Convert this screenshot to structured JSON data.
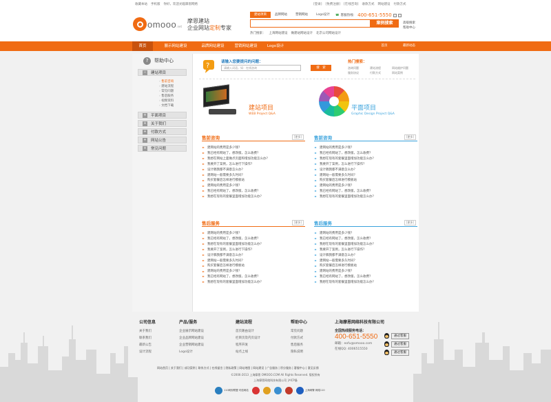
{
  "topbar": {
    "left": [
      "收藏本站",
      "手机版",
      "你好，欢迎光临摩恩网络"
    ],
    "right": [
      "[登录]",
      "[免费注册]",
      "[在线咨询]",
      "收款方式",
      "网站建设",
      "付款方式"
    ]
  },
  "header": {
    "logo_text": "omooo",
    "logo_suffix": ".net",
    "slogan_line1": "摩恩建站",
    "slogan_line2_pre": "企业网站",
    "slogan_line2_accent": "定制",
    "slogan_line2_post": "专家",
    "search_tabs": [
      "建站项目",
      "品牌网站",
      "营销网站",
      "Logo设计"
    ],
    "search_placeholder": "",
    "search_button": "案例搜索",
    "hotline_label": "客服热线：",
    "hotline_number": "400-651-5550",
    "side_links": [
      "高级搜索",
      "帮助中心"
    ],
    "hot_search_label": "热门搜索：",
    "hot_search": [
      "上海网站建设",
      "做建站网站设计",
      "北京公司网站设计"
    ]
  },
  "nav": {
    "items": [
      "首页",
      "展示网站建设",
      "品牌网站建设",
      "营销网站建设",
      "Logo设计"
    ],
    "right": [
      "设计作品展示",
      "最新动态"
    ]
  },
  "sidebar": {
    "title": "帮助中心",
    "sections": [
      {
        "label": "建站项目"
      },
      {
        "label": "平面项目"
      },
      {
        "label": "关于我们"
      },
      {
        "label": "付款方式"
      },
      {
        "label": "网站公告"
      },
      {
        "label": "常见问题"
      }
    ],
    "sub_items": [
      "售前咨询",
      "建站流程",
      "常见问题",
      "售后服务",
      "视频资料",
      "文档下载"
    ]
  },
  "question": {
    "label": "请输入您要提问的问题：",
    "input_placeholder": "请输入词语，如：在线咨询",
    "button": "搜　索",
    "hot_title": "热门搜索：",
    "hot_items": [
      "咨询问题",
      "建站流程",
      "网站维护问题",
      "服务协议",
      "付款方式",
      "网站案例"
    ]
  },
  "projects": [
    {
      "title": "建站项目",
      "subtitle": "WEB Project Q&A"
    },
    {
      "title": "平面项目",
      "subtitle": "Graphic Design Project Q&A"
    }
  ],
  "blocks": [
    {
      "title": "售前咨询",
      "more": "[更多]",
      "color": "orange",
      "items": [
        "建网站的费用是多少钱？",
        "我已经有网站了，想改版，怎么收费？",
        "我想在网站上面做点页面和增加功能怎么办？",
        "我要开了案例，怎么进行下操作？",
        "设计稿我都不满意怎么办？",
        "建网站一般需要多久时间？",
        "购买套餐后怎样进行模板站",
        "建网站的费用是多少钱？",
        "我已经有网站了，想改版，怎么收费？",
        "我想在现有的套餐里面增加功能怎么办？"
      ]
    },
    {
      "title": "售前咨询",
      "more": "[更多]",
      "color": "blue",
      "items": [
        "建网站的费用是多少钱？",
        "我已经有网站了，想改版，怎么收费？",
        "我想在现有的套餐里面增加功能怎么办？",
        "我要开了案例，怎么进行下操作？",
        "设计稿我都不满意怎么办？",
        "建网站一般需要多久时间？",
        "购买套餐后怎样进行模板站",
        "建网站的费用是多少钱？",
        "我已经有网站了，想改版，怎么收费？",
        "我想在现有的套餐里面增加功能怎么办？"
      ]
    },
    {
      "title": "售后服务",
      "more": "[更多]",
      "color": "orange",
      "items": [
        "建网站的费用是多少钱？",
        "我已经有网站了，想改版，怎么收费？",
        "我想在现有的套餐里面增加功能怎么办？",
        "我要开了案例，怎么进行下操作？",
        "设计稿我都不满意怎么办？",
        "建网站一般需要多久时间？",
        "购买套餐后怎样进行模板站",
        "建网站的费用是多少钱？",
        "我已经有网站了，想改版，怎么收费？",
        "我想在现有的套餐里面增加功能怎么办？"
      ]
    },
    {
      "title": "售后服务",
      "more": "[更多]",
      "color": "blue",
      "items": [
        "建网站的费用是多少钱？",
        "我已经有网站了，想改版，怎么收费？",
        "我想在现有的套餐里面增加功能怎么办？",
        "我要开了案例，怎么进行下操作？",
        "设计稿我都不满意怎么办？",
        "建网站一般需要多久时间？",
        "购买套餐后怎样进行模板站",
        "建网站的费用是多少钱？",
        "我已经有网站了，想改版，怎么收费？",
        "我想在现有的套餐里面增加功能怎么办？"
      ]
    }
  ],
  "footer": {
    "cols": [
      {
        "title": "公司信息",
        "items": [
          "关于我们",
          "联系我们",
          "最新公告",
          "设计流程"
        ]
      },
      {
        "title": "产品/服务",
        "items": [
          "企业展示网站建设",
          "企业品牌网站建设",
          "企业营销网站建设",
          "Logo设计"
        ]
      },
      {
        "title": "建站流程",
        "items": [
          "首页路由设计",
          "栏目页及内页设计",
          "程序开发",
          "站点上线"
        ]
      },
      {
        "title": "帮助中心",
        "items": [
          "常见问题",
          "付款方式",
          "售后服务",
          "隐私说明"
        ]
      }
    ],
    "company": "上海摩恩网络科技有限公司",
    "service_label": "全国热线服务电话：",
    "phone": "400-651-5550",
    "email": "邮箱：eofu@omooo.com",
    "support": "在线QQ: 4006515550",
    "qq_buttons": [
      "通过客服",
      "通过客服",
      "通过客服"
    ],
    "links": "网站首页 | 关于我们 | 成功案例 | 联系方式 | 在线留言 | 隐私政策 | 网站地图 | 网站建设 | 广告服务 | 积分服务 | 客服中心 | 意见反馈",
    "copyright": "©2006-2013 上海摩恩 OMOOO.COM All Rights Reserved. 版权所有",
    "icp": "上海摩恩网络科技有限公司 沪ICP备",
    "badges": [
      "110网安联盟 可信网站",
      "",
      "",
      "",
      "",
      "上海网警 网络110"
    ]
  }
}
